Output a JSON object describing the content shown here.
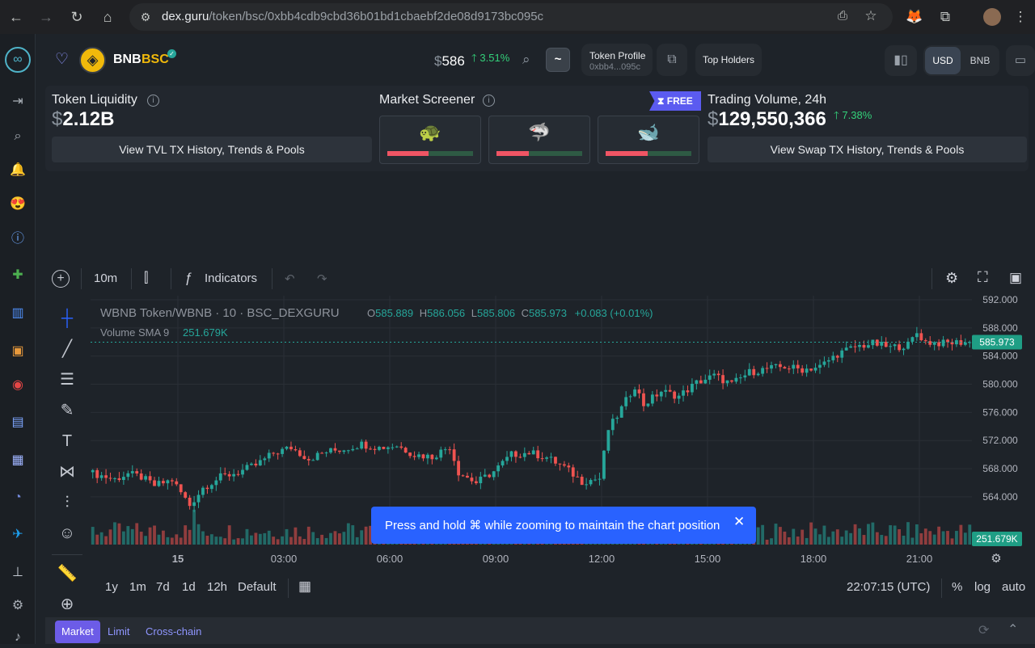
{
  "browser": {
    "url_host": "dex.guru",
    "url_path": "/token/bsc/0xbb4cdb9cbd36b01bd1cbaebf2de08d9173bc095c"
  },
  "header": {
    "chain_name": "BNB",
    "chain_tag": "BSC",
    "price_currency": "$",
    "price": "586",
    "price_change": "3.51%",
    "tilde_label": "~",
    "token_profile_label": "Token Profile",
    "token_profile_address": "0xbb4...095c",
    "top_holders_label": "Top Holders",
    "currency_usd": "USD",
    "currency_bnb": "BNB"
  },
  "stats": {
    "liquidity_title": "Token Liquidity",
    "liquidity_currency": "$",
    "liquidity_value": "2.12B",
    "liquidity_button": "View TVL TX History, Trends & Pools",
    "screener_title": "Market Screener",
    "free_badge": "FREE",
    "screener_cards": [
      {
        "emoji": "🐢",
        "red_fraction": 0.48
      },
      {
        "emoji": "🦈",
        "red_fraction": 0.38
      },
      {
        "emoji": "🐋",
        "red_fraction": 0.49
      }
    ],
    "volume_title": "Trading Volume, 24h",
    "volume_currency": "$",
    "volume_value": "129,550,366",
    "volume_change": "7.38%",
    "volume_button": "View Swap TX History, Trends & Pools"
  },
  "chart_toolbar": {
    "interval": "10m",
    "indicators_label": "Indicators"
  },
  "legend": {
    "symbol": "WBNB Token/WBNB · 10 · BSC_DEXGURU",
    "o_label": "O",
    "o_value": "585.889",
    "h_label": "H",
    "h_value": "586.056",
    "l_label": "L",
    "l_value": "585.806",
    "c_label": "C",
    "c_value": "585.973",
    "change": "+0.083 (+0.01%)",
    "volume_label": "Volume SMA 9",
    "volume_value": "251.679K"
  },
  "chart_data": {
    "type": "candlestick",
    "y_ticks": [
      "592.000",
      "588.000",
      "584.000",
      "580.000",
      "576.000",
      "572.000",
      "568.000",
      "564.000"
    ],
    "y_tick_values": [
      592,
      588,
      584,
      580,
      576,
      572,
      568,
      564
    ],
    "x_ticks": [
      "15",
      "03:00",
      "06:00",
      "09:00",
      "12:00",
      "15:00",
      "18:00",
      "21:00"
    ],
    "last_price_label": "585.973",
    "last_price": 585.973,
    "volume_badge": "251.679K",
    "ylim": [
      562.5,
      592
    ],
    "close_path": [
      [
        0,
        567.5
      ],
      [
        3,
        567.0
      ],
      [
        6,
        566.5
      ],
      [
        9,
        567.3
      ],
      [
        12,
        566.8
      ],
      [
        15,
        565.6
      ],
      [
        19,
        566.4
      ],
      [
        23,
        562.8
      ],
      [
        26,
        565.3
      ],
      [
        30,
        566.8
      ],
      [
        34,
        567.5
      ],
      [
        38,
        568.5
      ],
      [
        42,
        570.2
      ],
      [
        46,
        571.0
      ],
      [
        50,
        569.4
      ],
      [
        54,
        570.4
      ],
      [
        58,
        570.8
      ],
      [
        62,
        571.5
      ],
      [
        66,
        571.0
      ],
      [
        70,
        571.3
      ],
      [
        74,
        570.0
      ],
      [
        78,
        569.7
      ],
      [
        82,
        571.2
      ],
      [
        84,
        567.5
      ],
      [
        88,
        566.0
      ],
      [
        92,
        567.6
      ],
      [
        96,
        570.0
      ],
      [
        100,
        570.3
      ],
      [
        104,
        569.6
      ],
      [
        108,
        568.2
      ],
      [
        112,
        566.2
      ],
      [
        116,
        566.6
      ],
      [
        118,
        573.6
      ],
      [
        120,
        575.5
      ],
      [
        124,
        579.8
      ],
      [
        126,
        577.1
      ],
      [
        130,
        579.0
      ],
      [
        134,
        578.3
      ],
      [
        138,
        580.2
      ],
      [
        142,
        581.2
      ],
      [
        146,
        580.0
      ],
      [
        150,
        581.7
      ],
      [
        154,
        582.2
      ],
      [
        158,
        582.5
      ],
      [
        162,
        582.1
      ],
      [
        166,
        582.5
      ],
      [
        170,
        584.3
      ],
      [
        174,
        585.3
      ],
      [
        178,
        585.8
      ],
      [
        182,
        585.2
      ],
      [
        186,
        585.6
      ],
      [
        188,
        587.3
      ],
      [
        190,
        586.0
      ],
      [
        194,
        585.8
      ],
      [
        198,
        585.973
      ]
    ],
    "volume_spikes": [
      [
        23,
        0.9
      ],
      [
        69,
        0.95
      ],
      [
        89,
        0.8
      ],
      [
        120,
        0.85
      ],
      [
        142,
        0.75
      ]
    ]
  },
  "toast": {
    "message": "Press and hold ⌘ while zooming to maintain the chart position"
  },
  "timeframes": {
    "items": [
      "1y",
      "1m",
      "7d",
      "1d",
      "12h",
      "Default"
    ],
    "clock": "22:07:15 (UTC)",
    "percent_label": "%",
    "log_label": "log",
    "auto_label": "auto"
  },
  "bottom_tabs": {
    "market": "Market",
    "limit": "Limit",
    "cross_chain": "Cross-chain"
  },
  "colors": {
    "up": "#26a69a",
    "down": "#ef5350",
    "accent": "#5b6cf6",
    "badge_green": "#1f9e85"
  }
}
